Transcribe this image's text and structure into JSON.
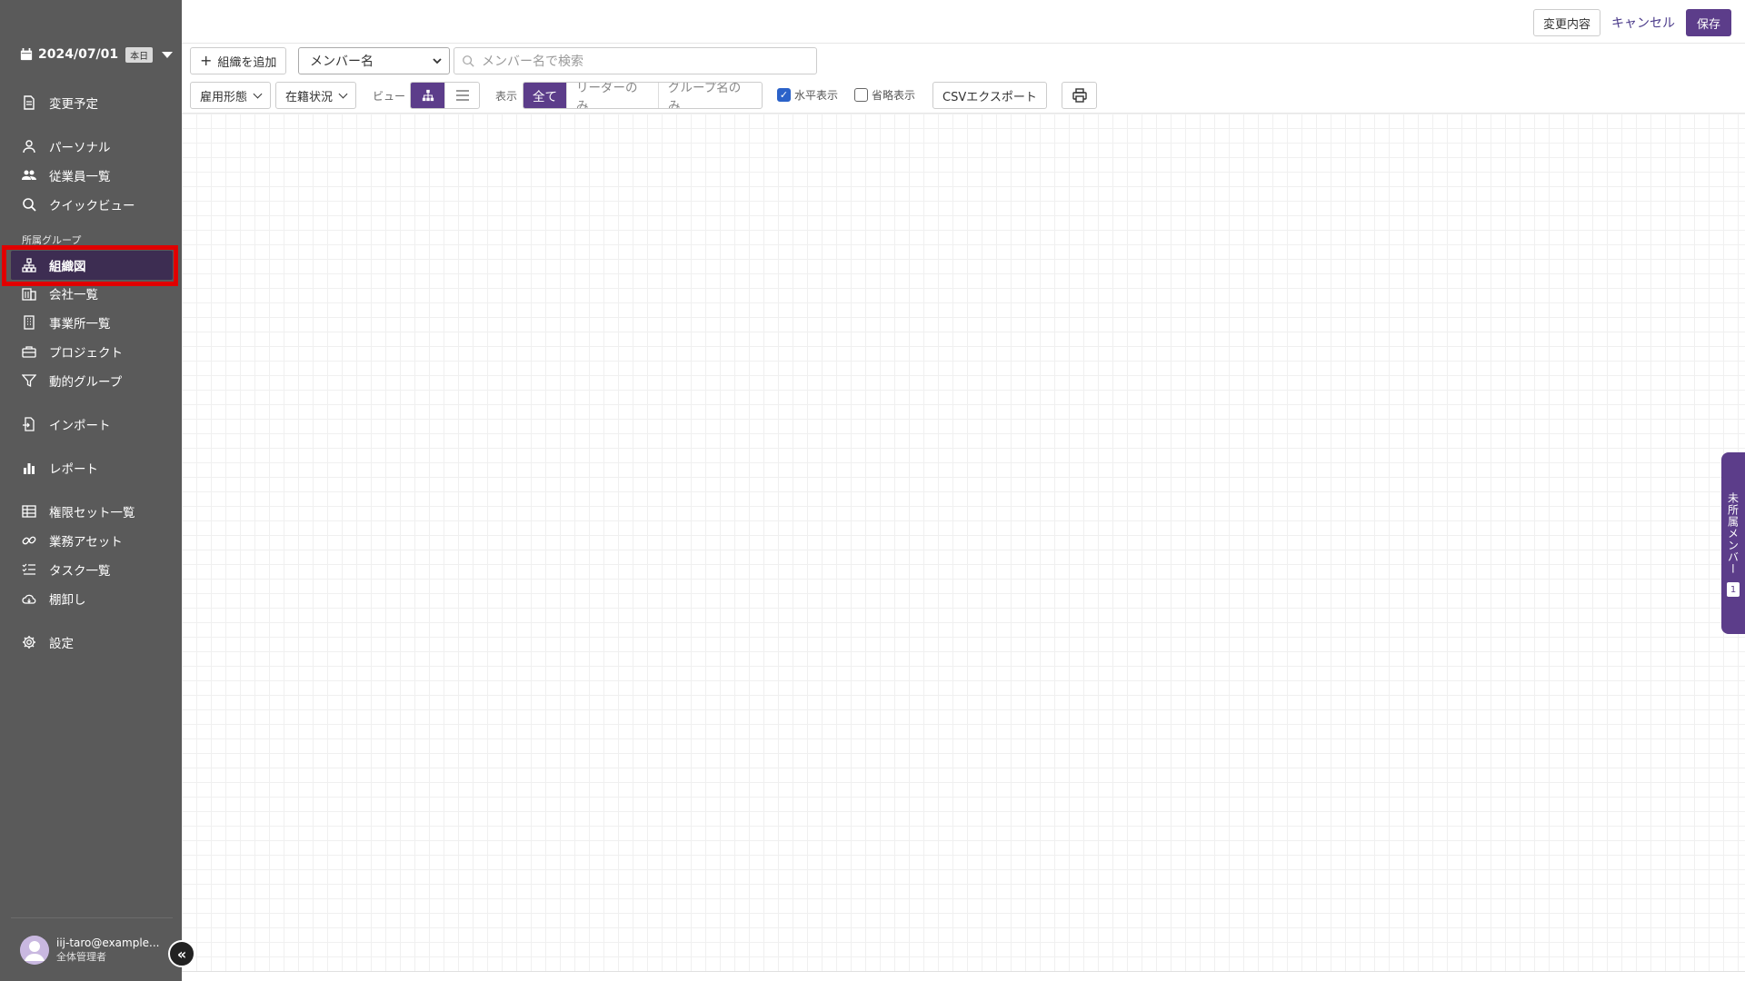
{
  "sidebar": {
    "date": "2024/07/01",
    "today_label": "本日",
    "section_label": "所属グループ",
    "items": [
      {
        "label": "変更予定",
        "icon": "document-icon"
      },
      {
        "label": "パーソナル",
        "icon": "person-icon"
      },
      {
        "label": "従業員一覧",
        "icon": "people-icon"
      },
      {
        "label": "クイックビュー",
        "icon": "search-icon"
      },
      {
        "label": "組織図",
        "icon": "org-chart-icon",
        "active": true
      },
      {
        "label": "会社一覧",
        "icon": "building-icon"
      },
      {
        "label": "事業所一覧",
        "icon": "office-icon"
      },
      {
        "label": "プロジェクト",
        "icon": "briefcase-icon"
      },
      {
        "label": "動的グループ",
        "icon": "filter-icon"
      },
      {
        "label": "インポート",
        "icon": "import-icon"
      },
      {
        "label": "レポート",
        "icon": "bar-chart-icon"
      },
      {
        "label": "権限セット一覧",
        "icon": "grid-icon"
      },
      {
        "label": "業務アセット",
        "icon": "link-icon"
      },
      {
        "label": "タスク一覧",
        "icon": "task-list-icon"
      },
      {
        "label": "棚卸し",
        "icon": "cloud-icon"
      },
      {
        "label": "設定",
        "icon": "gear-icon"
      }
    ],
    "user": {
      "email": "iij-taro@example...",
      "role": "全体管理者"
    }
  },
  "topbar": {
    "changes_label": "変更内容",
    "cancel_label": "キャンセル",
    "save_label": "保存"
  },
  "toolbar": {
    "add_org_label": "組織を追加",
    "member_select_value": "メンバー名",
    "search_placeholder": "メンバー名で検索",
    "employment_type_label": "雇用形態",
    "status_label": "在籍状況",
    "view_label": "ビュー",
    "display_label": "表示",
    "display_options": [
      "全て",
      "リーダーのみ",
      "グループ名のみ"
    ],
    "display_selected": "全て",
    "horizontal_label": "水平表示",
    "horizontal_checked": true,
    "abbrev_label": "省略表示",
    "abbrev_checked": false,
    "csv_label": "CSVエクスポート"
  },
  "side_panel": {
    "label": "未所属メンバー",
    "count": "1"
  },
  "colors": {
    "sidebar_bg": "#5a5a5a",
    "accent": "#5c3d8a",
    "active_item": "#3d2d52",
    "highlight": "#e00000"
  }
}
